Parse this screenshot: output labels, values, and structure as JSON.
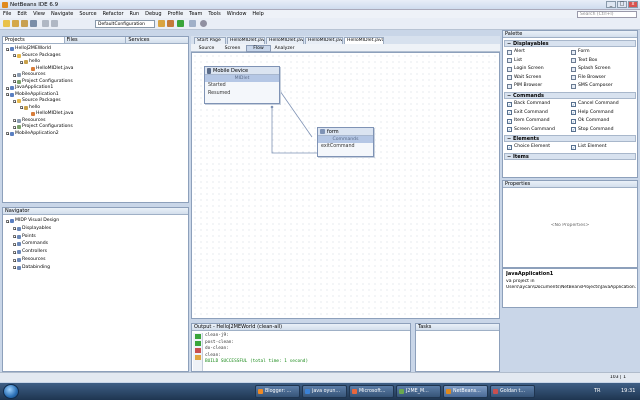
{
  "window": {
    "title": "NetBeans IDE 6.9",
    "search_placeholder": "Search (Ctrl+I)",
    "btn_min": "_",
    "btn_max": "□",
    "btn_close": "x"
  },
  "menu": [
    "File",
    "Edit",
    "View",
    "Navigate",
    "Source",
    "Refactor",
    "Run",
    "Debug",
    "Profile",
    "Team",
    "Tools",
    "Window",
    "Help"
  ],
  "toolbar": {
    "config": "DefaultConfiguration"
  },
  "projects_panel": {
    "tabs": [
      "Projects",
      "Files",
      "Services"
    ],
    "tree": [
      {
        "label": "HelloJ2MEWorld",
        "indent": 0,
        "icon": "proj",
        "expander": "−"
      },
      {
        "label": "Source Packages",
        "indent": 1,
        "icon": "fold",
        "expander": "−"
      },
      {
        "label": "hello",
        "indent": 2,
        "icon": "pkg",
        "expander": "−"
      },
      {
        "label": "HelloMIDlet.java",
        "indent": 3,
        "icon": "java",
        "expander": ""
      },
      {
        "label": "Resources",
        "indent": 1,
        "icon": "res",
        "expander": "+"
      },
      {
        "label": "Project Configurations",
        "indent": 1,
        "icon": "cfg",
        "expander": "+"
      },
      {
        "label": "JavaApplication1",
        "indent": 0,
        "icon": "proj",
        "expander": "+"
      },
      {
        "label": "MobileApplication1",
        "indent": 0,
        "icon": "proj",
        "expander": "−"
      },
      {
        "label": "Source Packages",
        "indent": 1,
        "icon": "fold",
        "expander": "−"
      },
      {
        "label": "hello",
        "indent": 2,
        "icon": "pkg",
        "expander": "−"
      },
      {
        "label": "HelloMIDlet.java",
        "indent": 3,
        "icon": "java",
        "expander": ""
      },
      {
        "label": "Resources",
        "indent": 1,
        "icon": "res",
        "expander": "+"
      },
      {
        "label": "Project Configurations",
        "indent": 1,
        "icon": "cfg",
        "expander": "+"
      },
      {
        "label": "MobileApplication2",
        "indent": 0,
        "icon": "proj",
        "expander": "+"
      }
    ]
  },
  "navigator_panel": {
    "title": "Navigator",
    "tree": [
      {
        "label": "MIDP Visual Design",
        "indent": 0
      },
      {
        "label": "Displayables",
        "indent": 1
      },
      {
        "label": "Points",
        "indent": 1
      },
      {
        "label": "Commands",
        "indent": 1
      },
      {
        "label": "Controllers",
        "indent": 1
      },
      {
        "label": "Resources",
        "indent": 1
      },
      {
        "label": "Databinding",
        "indent": 1
      }
    ]
  },
  "editor": {
    "tabs": [
      {
        "label": "Start Page",
        "active": false
      },
      {
        "label": "HelloMIDlet.java",
        "active": false
      },
      {
        "label": "HelloMIDlet.java",
        "active": false
      },
      {
        "label": "HelloMIDlet.java",
        "active": false
      },
      {
        "label": "HelloMIDlet.java",
        "active": true
      }
    ],
    "view_tabs": [
      {
        "label": "Source",
        "active": false
      },
      {
        "label": "Screen",
        "active": false
      },
      {
        "label": "Flow",
        "active": true
      },
      {
        "label": "Analyzer",
        "active": false
      }
    ],
    "flow": {
      "mobile_device": {
        "title": "Mobile Device",
        "sub": "MIDlet",
        "rows": [
          "Started",
          "Resumed"
        ]
      },
      "form": {
        "title": "form",
        "sub": "Commands",
        "rows": [
          "exitCommand"
        ]
      }
    }
  },
  "palette": {
    "title": "Palette",
    "categories": [
      {
        "name": "Displayables",
        "items": [
          "Alert",
          "Form",
          "List",
          "Text Box",
          "Login Screen",
          "Splash Screen",
          "Wait Screen",
          "File Browser",
          "PIM Browser",
          "SMS Composer"
        ]
      },
      {
        "name": "Commands",
        "items": [
          "Back Command",
          "Cancel Command",
          "Exit Command",
          "Help Command",
          "Item Command",
          "Ok Command",
          "Screen Command",
          "Stop Command"
        ]
      },
      {
        "name": "Elements",
        "items": [
          "Choice Element",
          "List Element"
        ]
      },
      {
        "name": "Items",
        "items": []
      }
    ]
  },
  "properties": {
    "title": "Properties",
    "empty": "<No Properties>"
  },
  "info": {
    "title": "JavaApplication1",
    "desc": "va project in",
    "path": "Users\\aycan\\Documents\\NetBeansProjects\\JavaApplication1"
  },
  "output": {
    "title": "Output - HelloJ2MEWorld (clean-all)",
    "tasks_tab": "Tasks",
    "lines": [
      {
        "text": "clean-j9:",
        "color": "#333"
      },
      {
        "text": "post-clean:",
        "color": "#333"
      },
      {
        "text": "do-clean:",
        "color": "#333"
      },
      {
        "text": "clean:",
        "color": "#333"
      },
      {
        "text": "BUILD SUCCESSFUL (total time: 1 second)",
        "color": "#1a8a1a"
      }
    ]
  },
  "status": {
    "position": "103 | 1"
  },
  "taskbar": {
    "items": [
      {
        "label": "Blogger: ...",
        "color": "#f08a24"
      },
      {
        "label": "java oyun...",
        "color": "#3b82d6"
      },
      {
        "label": "Microsoft...",
        "color": "#e8663c"
      },
      {
        "label": "J2ME_M...",
        "color": "#6aa84f"
      },
      {
        "label": "NetBeans...",
        "color": "#e08a1e",
        "active": true
      },
      {
        "label": "Goldan t...",
        "color": "#c94f4f"
      }
    ],
    "tray": {
      "lang": "TR",
      "time": "19:31"
    }
  }
}
